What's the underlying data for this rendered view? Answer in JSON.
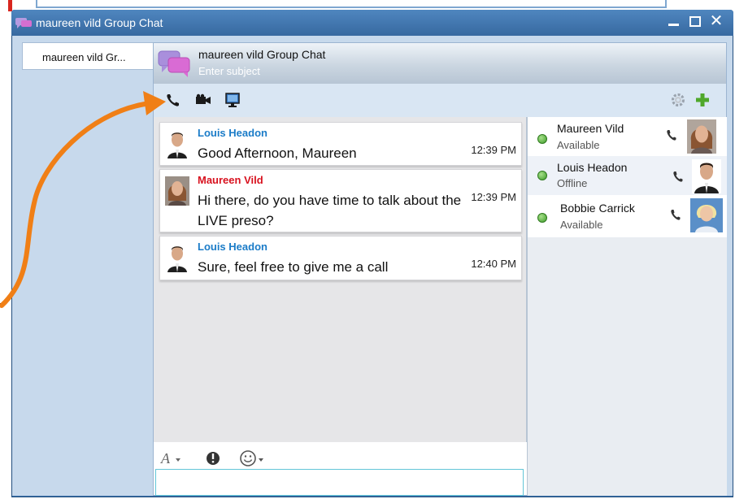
{
  "window": {
    "title": "maureen vild Group Chat",
    "close_glyph": "✕"
  },
  "tabs": [
    {
      "label": "maureen vild Gr..."
    }
  ],
  "header": {
    "title": "maureen vild Group Chat",
    "subject_placeholder": "Enter subject"
  },
  "toolbar": {
    "icons": [
      "phone-icon",
      "video-icon",
      "screen-share-icon",
      "settings-icon",
      "add-participant-icon"
    ]
  },
  "messages": [
    {
      "sender": "Louis Headon",
      "sender_color": "#1b7cc8",
      "text": "Good Afternoon, Maureen",
      "time": "12:39 PM"
    },
    {
      "sender": "Maureen Vild",
      "sender_color": "#d8121f",
      "text": "Hi there, do you have time to talk about the LIVE preso?",
      "time": "12:39 PM"
    },
    {
      "sender": "Louis Headon",
      "sender_color": "#1b7cc8",
      "text": "Sure, feel free to give me a call",
      "time": "12:40 PM"
    }
  ],
  "compose": {
    "format_icons": [
      "font-format-icon",
      "priority-icon",
      "emoticon-icon"
    ],
    "input_value": ""
  },
  "participants": [
    {
      "name": "Maureen Vild",
      "status": "Available"
    },
    {
      "name": "Louis Headon",
      "status": "Offline"
    },
    {
      "name": "Bobbie Carrick",
      "status": "Available"
    }
  ],
  "colors": {
    "title_bar": "#3a6fa8",
    "accent_blue": "#1b7cc8",
    "accent_red": "#d8121f",
    "presence_green": "#3e9c2a",
    "annotation_orange": "#f07f16"
  }
}
